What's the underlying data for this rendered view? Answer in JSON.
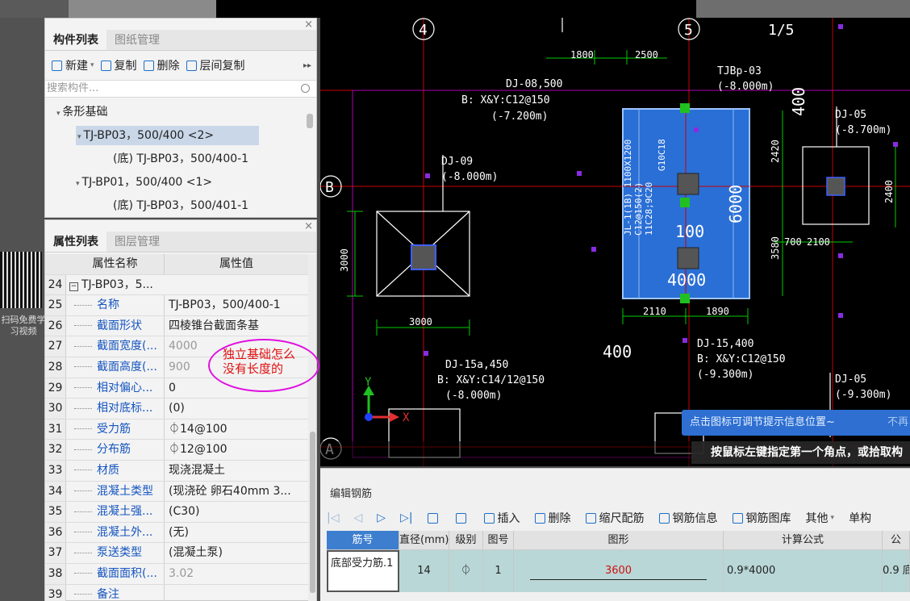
{
  "component_panel": {
    "tabs": [
      "构件列表",
      "图纸管理"
    ],
    "close": "×",
    "toolbar": {
      "new": "新建",
      "copy": "复制",
      "delete": "删除",
      "floor_copy": "层间复制",
      "more": "▸▸"
    },
    "search_placeholder": "搜索构件...",
    "tree": [
      {
        "label": "条形基础",
        "level": 0,
        "arrow": "▾"
      },
      {
        "label": "TJ-BP03，500/400 <2>",
        "level": 1,
        "arrow": "▾",
        "selected": true
      },
      {
        "label": "(底) TJ-BP03，500/400-1",
        "level": 2,
        "arrow": ""
      },
      {
        "label": "TJ-BP01，500/400 <1>",
        "level": 1,
        "arrow": "▾"
      },
      {
        "label": "(底) TJ-BP03，500/401-1",
        "level": 2,
        "arrow": ""
      }
    ]
  },
  "property_panel": {
    "tabs": [
      "属性列表",
      "图层管理"
    ],
    "header": {
      "name": "属性名称",
      "value": "属性值"
    },
    "group_row": {
      "num": "24",
      "label": "TJ-BP03，5..."
    },
    "rows": [
      {
        "num": "25",
        "name": "名称",
        "value": "TJ-BP03，500/400-1",
        "gray": false
      },
      {
        "num": "26",
        "name": "截面形状",
        "value": "四棱锥台截面条基",
        "gray": false
      },
      {
        "num": "27",
        "name": "截面宽度(...",
        "value": "4000",
        "gray": true
      },
      {
        "num": "28",
        "name": "截面高度(...",
        "value": "900",
        "gray": true
      },
      {
        "num": "29",
        "name": "相对偏心...",
        "value": "0",
        "gray": false
      },
      {
        "num": "30",
        "name": "相对底标...",
        "value": "(0)",
        "gray": false
      },
      {
        "num": "31",
        "name": "受力筋",
        "value": "⏀14@100",
        "gray": false
      },
      {
        "num": "32",
        "name": "分布筋",
        "value": "⏀12@100",
        "gray": false
      },
      {
        "num": "33",
        "name": "材质",
        "value": "现浇混凝土",
        "gray": false
      },
      {
        "num": "34",
        "name": "混凝土类型",
        "value": "(现浇砼 卵石40mm 3...",
        "gray": false
      },
      {
        "num": "35",
        "name": "混凝土强...",
        "value": "(C30)",
        "gray": false
      },
      {
        "num": "36",
        "name": "混凝土外...",
        "value": "(无)",
        "gray": false
      },
      {
        "num": "37",
        "name": "泵送类型",
        "value": "(混凝土泵)",
        "gray": false
      },
      {
        "num": "38",
        "name": "截面面积(...",
        "value": "3.02",
        "gray": true
      },
      {
        "num": "39",
        "name": "备注",
        "value": "",
        "gray": false
      }
    ]
  },
  "annotation": {
    "line1": "独立基础怎么",
    "line2": "没有长度的"
  },
  "sidebar_ad": {
    "text": "扫码免费学习视频"
  },
  "cad": {
    "axis_labels": [
      "4",
      "5",
      "1/5",
      "B",
      "A"
    ],
    "texts": {
      "dj08": "DJ-08,500",
      "dj08_b": "B: X&Y:C12@150",
      "dj08_el": "(-7.200m)",
      "tjbp": "TJBp-03",
      "tjbp_el": "(-8.000m)",
      "dj05": "DJ-05",
      "dj05_el": "(-8.700m)",
      "dj09": "DJ-09",
      "dj09_el": "(-8.000m)",
      "dj15": "DJ-15,400",
      "dj15_b": "B: X&Y:C12@150",
      "dj15_el": "(-9.300m)",
      "dj15a": "DJ-15a,450",
      "dj15a_b": "B: X&Y:C14/12@150",
      "dj15a_el": "(-8.000m)",
      "dj05b": "DJ-05",
      "dj05b_el": "(-9.300m)",
      "beam": "JL-1(1B) 1100X1200",
      "beam2": "C12@150(2)",
      "beam3": "11C28;9C20",
      "beam4": "G10C18",
      "dim_1800": "1800",
      "dim_2500": "2500",
      "dim_400a": "400",
      "dim_400b": "400",
      "dim_2420": "2420",
      "dim_6000": "6000",
      "dim_100": "100",
      "dim_4000": "4000",
      "dim_3580": "3580",
      "dim_700": "700",
      "dim_2100": "2100",
      "dim_2400": "2400",
      "dim_2110": "2110",
      "dim_1890": "1890",
      "dim_3000a": "3000",
      "dim_3000b": "3000",
      "axis_x": "X",
      "axis_y": "Y"
    },
    "tip": "点击图标可调节提示信息位置~",
    "tip_no": "不再",
    "prompt": "按鼠标左键指定第一个角点，或拾取构"
  },
  "rebar_editor": {
    "title": "编辑钢筋",
    "tools": {
      "insert": "插入",
      "delete": "删除",
      "scale": "缩尺配筋",
      "info": "钢筋信息",
      "library": "钢筋图库",
      "other": "其他",
      "single": "单构"
    },
    "columns": [
      "筋号",
      "直径(mm)",
      "级别",
      "图号",
      "图形",
      "计算公式",
      "公"
    ],
    "row": {
      "bar_name": "底部受力筋.1",
      "diameter": "14",
      "grade": "⏀",
      "figure_no": "1",
      "shape_length": "3600",
      "formula": "0.9*4000",
      "extra": "0.9 底"
    }
  }
}
